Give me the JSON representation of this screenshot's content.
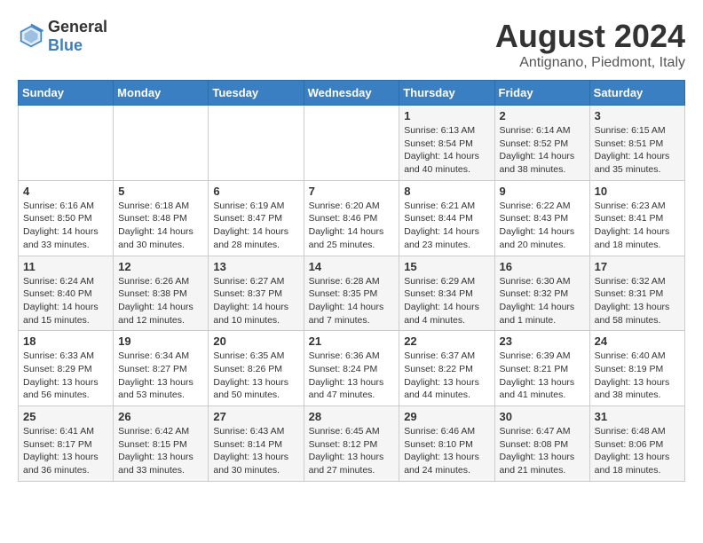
{
  "logo": {
    "text_general": "General",
    "text_blue": "Blue"
  },
  "title": {
    "month_year": "August 2024",
    "location": "Antignano, Piedmont, Italy"
  },
  "days_of_week": [
    "Sunday",
    "Monday",
    "Tuesday",
    "Wednesday",
    "Thursday",
    "Friday",
    "Saturday"
  ],
  "weeks": [
    [
      {
        "day": "",
        "sunrise": "",
        "sunset": "",
        "daylight": ""
      },
      {
        "day": "",
        "sunrise": "",
        "sunset": "",
        "daylight": ""
      },
      {
        "day": "",
        "sunrise": "",
        "sunset": "",
        "daylight": ""
      },
      {
        "day": "",
        "sunrise": "",
        "sunset": "",
        "daylight": ""
      },
      {
        "day": "1",
        "sunrise": "Sunrise: 6:13 AM",
        "sunset": "Sunset: 8:54 PM",
        "daylight": "Daylight: 14 hours and 40 minutes."
      },
      {
        "day": "2",
        "sunrise": "Sunrise: 6:14 AM",
        "sunset": "Sunset: 8:52 PM",
        "daylight": "Daylight: 14 hours and 38 minutes."
      },
      {
        "day": "3",
        "sunrise": "Sunrise: 6:15 AM",
        "sunset": "Sunset: 8:51 PM",
        "daylight": "Daylight: 14 hours and 35 minutes."
      }
    ],
    [
      {
        "day": "4",
        "sunrise": "Sunrise: 6:16 AM",
        "sunset": "Sunset: 8:50 PM",
        "daylight": "Daylight: 14 hours and 33 minutes."
      },
      {
        "day": "5",
        "sunrise": "Sunrise: 6:18 AM",
        "sunset": "Sunset: 8:48 PM",
        "daylight": "Daylight: 14 hours and 30 minutes."
      },
      {
        "day": "6",
        "sunrise": "Sunrise: 6:19 AM",
        "sunset": "Sunset: 8:47 PM",
        "daylight": "Daylight: 14 hours and 28 minutes."
      },
      {
        "day": "7",
        "sunrise": "Sunrise: 6:20 AM",
        "sunset": "Sunset: 8:46 PM",
        "daylight": "Daylight: 14 hours and 25 minutes."
      },
      {
        "day": "8",
        "sunrise": "Sunrise: 6:21 AM",
        "sunset": "Sunset: 8:44 PM",
        "daylight": "Daylight: 14 hours and 23 minutes."
      },
      {
        "day": "9",
        "sunrise": "Sunrise: 6:22 AM",
        "sunset": "Sunset: 8:43 PM",
        "daylight": "Daylight: 14 hours and 20 minutes."
      },
      {
        "day": "10",
        "sunrise": "Sunrise: 6:23 AM",
        "sunset": "Sunset: 8:41 PM",
        "daylight": "Daylight: 14 hours and 18 minutes."
      }
    ],
    [
      {
        "day": "11",
        "sunrise": "Sunrise: 6:24 AM",
        "sunset": "Sunset: 8:40 PM",
        "daylight": "Daylight: 14 hours and 15 minutes."
      },
      {
        "day": "12",
        "sunrise": "Sunrise: 6:26 AM",
        "sunset": "Sunset: 8:38 PM",
        "daylight": "Daylight: 14 hours and 12 minutes."
      },
      {
        "day": "13",
        "sunrise": "Sunrise: 6:27 AM",
        "sunset": "Sunset: 8:37 PM",
        "daylight": "Daylight: 14 hours and 10 minutes."
      },
      {
        "day": "14",
        "sunrise": "Sunrise: 6:28 AM",
        "sunset": "Sunset: 8:35 PM",
        "daylight": "Daylight: 14 hours and 7 minutes."
      },
      {
        "day": "15",
        "sunrise": "Sunrise: 6:29 AM",
        "sunset": "Sunset: 8:34 PM",
        "daylight": "Daylight: 14 hours and 4 minutes."
      },
      {
        "day": "16",
        "sunrise": "Sunrise: 6:30 AM",
        "sunset": "Sunset: 8:32 PM",
        "daylight": "Daylight: 14 hours and 1 minute."
      },
      {
        "day": "17",
        "sunrise": "Sunrise: 6:32 AM",
        "sunset": "Sunset: 8:31 PM",
        "daylight": "Daylight: 13 hours and 58 minutes."
      }
    ],
    [
      {
        "day": "18",
        "sunrise": "Sunrise: 6:33 AM",
        "sunset": "Sunset: 8:29 PM",
        "daylight": "Daylight: 13 hours and 56 minutes."
      },
      {
        "day": "19",
        "sunrise": "Sunrise: 6:34 AM",
        "sunset": "Sunset: 8:27 PM",
        "daylight": "Daylight: 13 hours and 53 minutes."
      },
      {
        "day": "20",
        "sunrise": "Sunrise: 6:35 AM",
        "sunset": "Sunset: 8:26 PM",
        "daylight": "Daylight: 13 hours and 50 minutes."
      },
      {
        "day": "21",
        "sunrise": "Sunrise: 6:36 AM",
        "sunset": "Sunset: 8:24 PM",
        "daylight": "Daylight: 13 hours and 47 minutes."
      },
      {
        "day": "22",
        "sunrise": "Sunrise: 6:37 AM",
        "sunset": "Sunset: 8:22 PM",
        "daylight": "Daylight: 13 hours and 44 minutes."
      },
      {
        "day": "23",
        "sunrise": "Sunrise: 6:39 AM",
        "sunset": "Sunset: 8:21 PM",
        "daylight": "Daylight: 13 hours and 41 minutes."
      },
      {
        "day": "24",
        "sunrise": "Sunrise: 6:40 AM",
        "sunset": "Sunset: 8:19 PM",
        "daylight": "Daylight: 13 hours and 38 minutes."
      }
    ],
    [
      {
        "day": "25",
        "sunrise": "Sunrise: 6:41 AM",
        "sunset": "Sunset: 8:17 PM",
        "daylight": "Daylight: 13 hours and 36 minutes."
      },
      {
        "day": "26",
        "sunrise": "Sunrise: 6:42 AM",
        "sunset": "Sunset: 8:15 PM",
        "daylight": "Daylight: 13 hours and 33 minutes."
      },
      {
        "day": "27",
        "sunrise": "Sunrise: 6:43 AM",
        "sunset": "Sunset: 8:14 PM",
        "daylight": "Daylight: 13 hours and 30 minutes."
      },
      {
        "day": "28",
        "sunrise": "Sunrise: 6:45 AM",
        "sunset": "Sunset: 8:12 PM",
        "daylight": "Daylight: 13 hours and 27 minutes."
      },
      {
        "day": "29",
        "sunrise": "Sunrise: 6:46 AM",
        "sunset": "Sunset: 8:10 PM",
        "daylight": "Daylight: 13 hours and 24 minutes."
      },
      {
        "day": "30",
        "sunrise": "Sunrise: 6:47 AM",
        "sunset": "Sunset: 8:08 PM",
        "daylight": "Daylight: 13 hours and 21 minutes."
      },
      {
        "day": "31",
        "sunrise": "Sunrise: 6:48 AM",
        "sunset": "Sunset: 8:06 PM",
        "daylight": "Daylight: 13 hours and 18 minutes."
      }
    ]
  ]
}
